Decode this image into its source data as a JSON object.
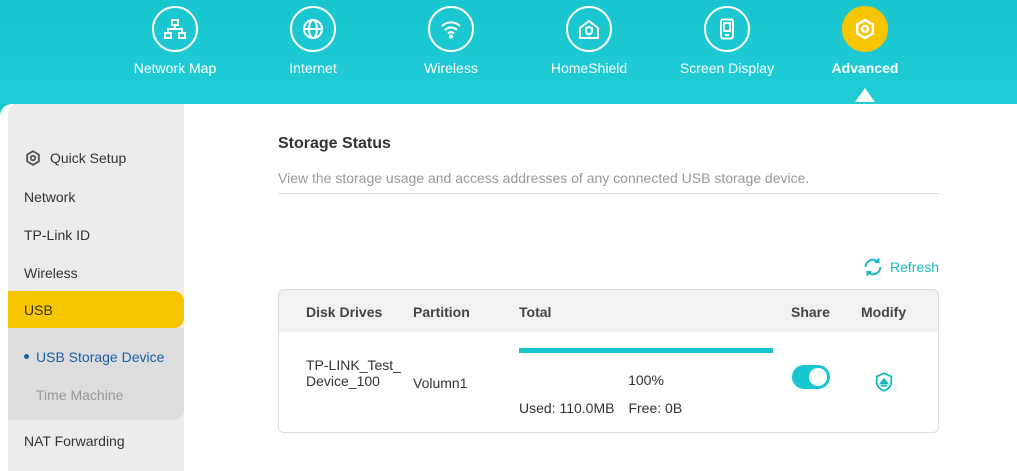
{
  "nav": {
    "items": [
      {
        "label": "Network Map",
        "icon": "network-map-icon"
      },
      {
        "label": "Internet",
        "icon": "globe-icon"
      },
      {
        "label": "Wireless",
        "icon": "wifi-icon"
      },
      {
        "label": "HomeShield",
        "icon": "homeshield-icon"
      },
      {
        "label": "Screen Display",
        "icon": "screen-display-icon"
      },
      {
        "label": "Advanced",
        "icon": "gear-icon",
        "active": true
      }
    ]
  },
  "sidebar": {
    "quick_setup": "Quick Setup",
    "items": [
      "Network",
      "TP-Link ID",
      "Wireless"
    ],
    "usb": "USB",
    "sub_items": [
      "USB Storage Device",
      "Time Machine"
    ],
    "after": "NAT Forwarding"
  },
  "main": {
    "title": "Storage Status",
    "description": "View the storage usage and access addresses of any connected USB storage device.",
    "refresh": "Refresh"
  },
  "table": {
    "headers": [
      "Disk Drives",
      "Partition",
      "Total",
      "Share",
      "Modify"
    ],
    "row": {
      "disk": "TP-LINK_Test_Device_100",
      "partition": "Volumn1",
      "percent": "100%",
      "used": "Used: 110.0MB",
      "free": "Free: 0B",
      "share_on": true
    }
  },
  "colors": {
    "accent": "#18c6cf",
    "active": "#f7c600",
    "link": "#1a5fa8"
  }
}
